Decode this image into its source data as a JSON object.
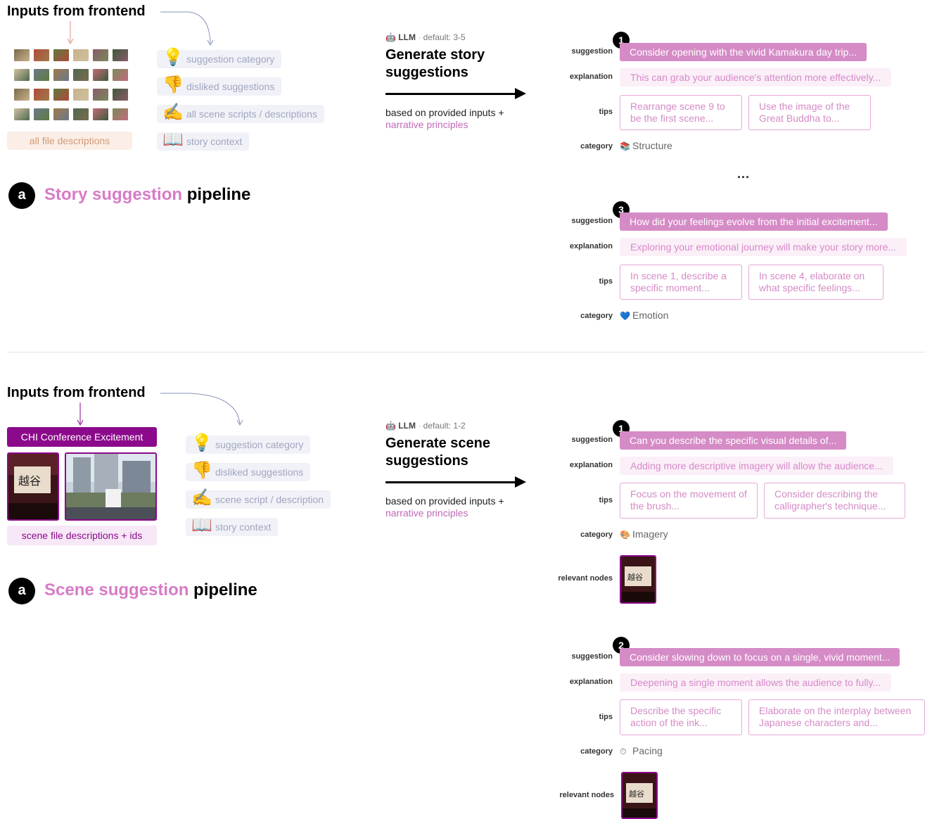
{
  "top": {
    "inputs_title": "Inputs from frontend",
    "file_descriptions_label": "all file descriptions",
    "input_chips": [
      {
        "icon": "lightbulb-icon",
        "glyph": "💡",
        "label": "suggestion category"
      },
      {
        "icon": "thumbs-down-icon",
        "glyph": "👎",
        "label": "disliked suggestions"
      },
      {
        "icon": "writing-hand-icon",
        "glyph": "✍️",
        "label": "all scene scripts / descriptions"
      },
      {
        "icon": "open-book-icon",
        "glyph": "📖",
        "label": "story context"
      }
    ],
    "llm_label": "LLM",
    "llm_default": "default: 3-5",
    "generate_title_line1": "Generate story",
    "generate_title_line2": "suggestions",
    "based_on": "based on provided inputs +",
    "narrative_principles": "narrative principles",
    "pipeline_badge": "a",
    "pipeline_pink": "Story suggestion",
    "pipeline_rest": " pipeline",
    "ellipsis": "...",
    "suggestions": [
      {
        "number": "1",
        "suggestion": "Consider opening with the vivid Kamakura day trip...",
        "explanation": "This can grab your audience's attention more effectively...",
        "tips": [
          "Rearrange scene 9 to be the first scene...",
          "Use the image of the Great Buddha to..."
        ],
        "category_icon": "books-icon",
        "category_glyph": "📚",
        "category": "Structure"
      },
      {
        "number": "3",
        "suggestion": "How did your feelings evolve from the initial excitement...",
        "explanation": "Exploring your emotional journey will make your story more...",
        "tips": [
          "In scene 1, describe a specific moment...",
          "In scene 4, elaborate on what specific feelings..."
        ],
        "category_icon": "blue-heart-icon",
        "category_glyph": "💙",
        "category": "Emotion"
      }
    ]
  },
  "bottom": {
    "inputs_title": "Inputs from frontend",
    "scene_title": "CHI Conference Excitement",
    "scene_files_label": "scene file descriptions + ids",
    "input_chips": [
      {
        "icon": "lightbulb-icon",
        "glyph": "💡",
        "label": "suggestion category"
      },
      {
        "icon": "thumbs-down-icon",
        "glyph": "👎",
        "label": "disliked suggestions"
      },
      {
        "icon": "writing-hand-icon",
        "glyph": "✍️",
        "label": "scene script / description"
      },
      {
        "icon": "open-book-icon",
        "glyph": "📖",
        "label": "story context"
      }
    ],
    "llm_label": "LLM",
    "llm_default": "default: 1-2",
    "generate_title_line1": "Generate scene",
    "generate_title_line2": "suggestions",
    "based_on": "based on provided inputs +",
    "narrative_principles": "narrative principles",
    "pipeline_badge": "a",
    "pipeline_pink": "Scene suggestion",
    "pipeline_rest": " pipeline",
    "suggestions": [
      {
        "number": "1",
        "suggestion": "Can you describe the specific visual details of...",
        "explanation": "Adding more descriptive imagery will allow the audience...",
        "tips": [
          "Focus on the movement of the brush...",
          "Consider describing the calligrapher's technique..."
        ],
        "category_icon": "palette-icon",
        "category_glyph": "🎨",
        "category": "Imagery"
      },
      {
        "number": "2",
        "suggestion": "Consider slowing down to focus on a single, vivid moment...",
        "explanation": "Deepening a single moment allows the audience to fully...",
        "tips": [
          "Describe the specific action of the ink...",
          "Elaborate on the interplay between Japanese characters and..."
        ],
        "category_icon": "stopwatch-icon",
        "category_glyph": "⏱",
        "category": "Pacing"
      }
    ]
  },
  "field_labels": {
    "suggestion": "suggestion",
    "explanation": "explanation",
    "tips": "tips",
    "category": "category",
    "relevant_nodes": "relevant nodes"
  },
  "colors": {
    "accent_pink": "#d58bc6",
    "light_pink": "#fbeff8",
    "scene_purple": "#8b0a8b",
    "chip_bg": "#f1f2f8",
    "file_desc_bg": "#fbeee6",
    "file_desc_text": "#d39a79"
  }
}
